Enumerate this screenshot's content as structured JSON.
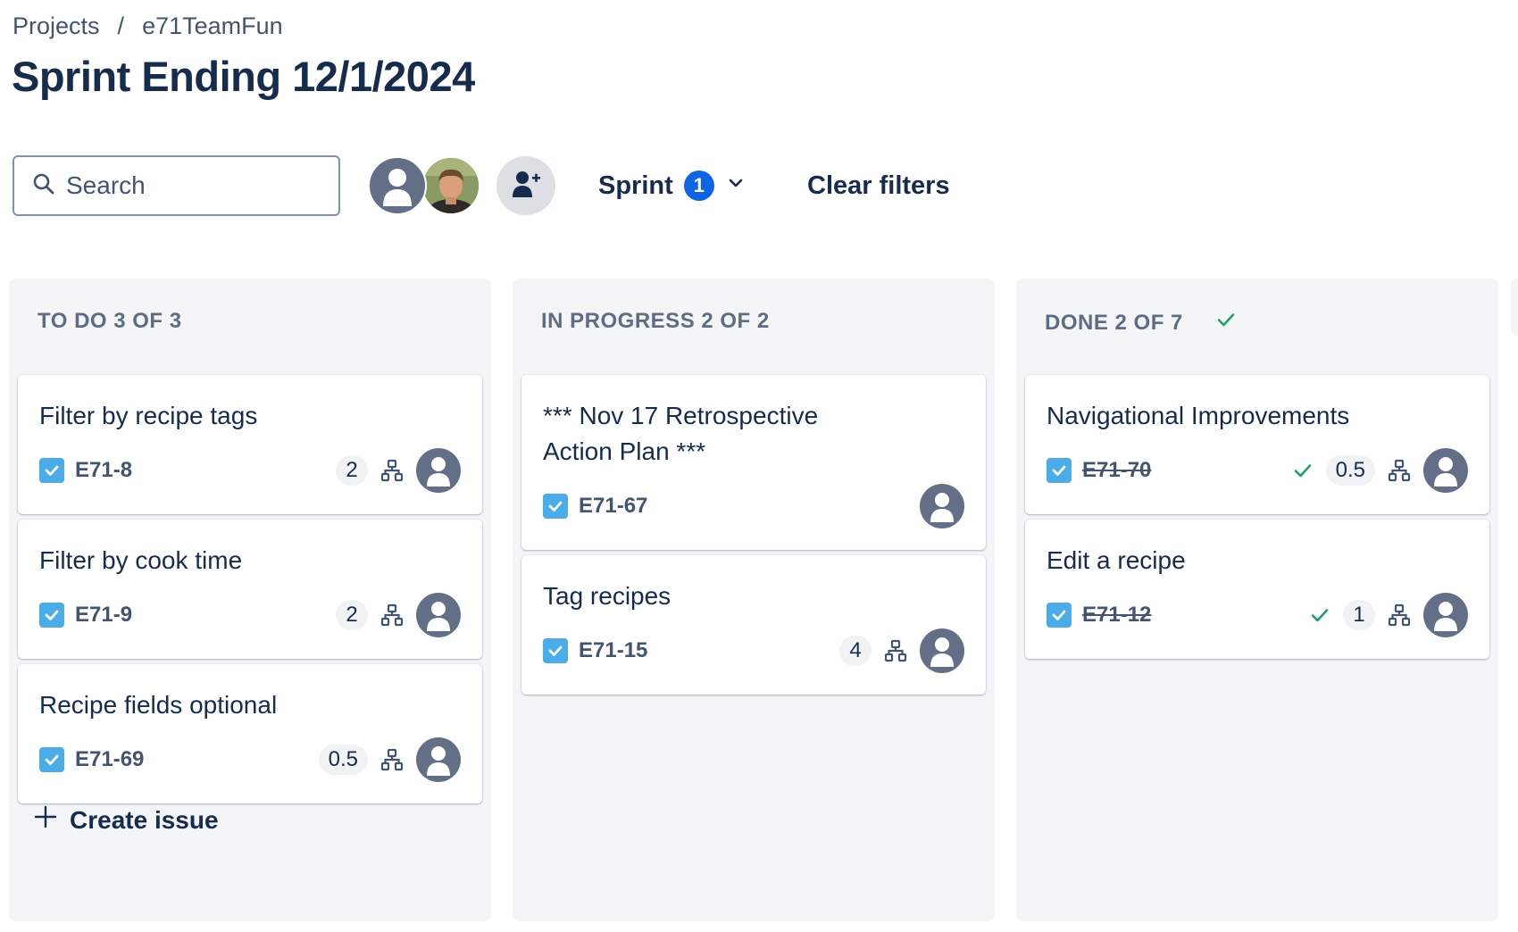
{
  "breadcrumb": {
    "projects": "Projects",
    "separator": "/",
    "project": "e71TeamFun"
  },
  "page_title": "Sprint Ending 12/1/2024",
  "toolbar": {
    "search_placeholder": "Search",
    "sprint_label": "Sprint",
    "sprint_count": "1",
    "clear_filters": "Clear filters"
  },
  "columns": [
    {
      "header": "TO DO 3 OF 3",
      "cards": [
        {
          "title": "Filter by recipe tags",
          "key": "E71-8",
          "points": "2"
        },
        {
          "title": "Filter by cook time",
          "key": "E71-9",
          "points": "2"
        },
        {
          "title": "Recipe fields optional",
          "key": "E71-69",
          "points": "0.5"
        }
      ],
      "create_issue": "Create issue"
    },
    {
      "header": "IN PROGRESS 2 OF 2",
      "cards": [
        {
          "title_line1": "*** Nov 17 Retrospective",
          "title_line2": "Action Plan ***",
          "key": "E71-67"
        },
        {
          "title": "Tag recipes",
          "key": "E71-15",
          "points": "4"
        }
      ]
    },
    {
      "header": "DONE 2 OF 7",
      "cards": [
        {
          "title": "Navigational Improvements",
          "key": "E71-70",
          "points": "0.5"
        },
        {
          "title": "Edit a recipe",
          "key": "E71-12",
          "points": "1"
        }
      ]
    }
  ],
  "colors": {
    "accent_blue": "#0c66e4",
    "task_icon": "#4bade8",
    "done_green": "#22a06b",
    "column_bg": "#f4f5f7",
    "avatar_gray": "#626f86"
  },
  "icons": [
    "search-icon",
    "add-person-icon",
    "chevron-down-icon",
    "checkmark-icon",
    "task-checkbox-icon",
    "hierarchy-icon",
    "plus-icon",
    "avatar-icon"
  ]
}
